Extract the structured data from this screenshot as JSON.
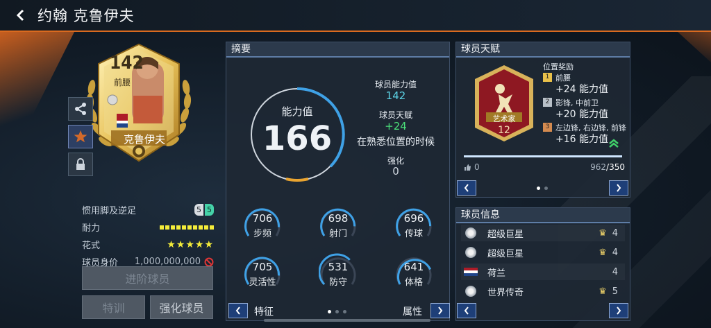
{
  "header": {
    "title": "约翰 克鲁伊夫"
  },
  "card": {
    "rating": "142",
    "position": "前腰",
    "name": "克鲁伊夫"
  },
  "left_stats": [
    {
      "label": "惯用脚及逆足",
      "value": "5 5"
    },
    {
      "label": "耐力",
      "value": ""
    },
    {
      "label": "花式",
      "value": "★★★★★"
    },
    {
      "label": "球员身价",
      "value": "1,000,000,000"
    }
  ],
  "stamina_level": 10,
  "buttons": {
    "advance": "进阶球员",
    "train": "特训",
    "strengthen": "强化球员"
  },
  "summary": {
    "title": "摘要",
    "ability_label": "能力值",
    "ability_value": "166",
    "player_ability_label": "球员能力值",
    "player_ability_value": "142",
    "talent_label": "球员天赋",
    "talent_value": "+24",
    "talent_desc": "在熟悉位置的时候",
    "strengthen_label": "强化",
    "strengthen_value": "0",
    "attrs": [
      {
        "value": "706",
        "label": "步频"
      },
      {
        "value": "698",
        "label": "射门"
      },
      {
        "value": "696",
        "label": "传球"
      },
      {
        "value": "705",
        "label": "灵活性"
      },
      {
        "value": "531",
        "label": "防守"
      },
      {
        "value": "641",
        "label": "体格"
      }
    ],
    "footer_left": "特征",
    "footer_right": "属性"
  },
  "talent": {
    "title": "球员天赋",
    "badge_name": "艺术家",
    "badge_level": "12",
    "bonus_title": "位置奖励",
    "bonuses": [
      {
        "rank": "1",
        "positions": "前腰",
        "bonus": "+24 能力值"
      },
      {
        "rank": "2",
        "positions": "影锋, 中前卫",
        "bonus": "+20 能力值"
      },
      {
        "rank": "3",
        "positions": "左边锋, 右边锋, 前锋",
        "bonus": "+16 能力值"
      }
    ],
    "likes": "0",
    "progress_current": "962",
    "progress_total": "/350"
  },
  "info": {
    "title": "球员信息",
    "rows": [
      {
        "label": "超级巨星",
        "value": "4"
      },
      {
        "label": "超级巨星",
        "value": "4"
      },
      {
        "label": "荷兰",
        "value": "4"
      },
      {
        "label": "世界传奇",
        "value": "5"
      }
    ]
  },
  "colors": {
    "accent_orange": "#d96a1f",
    "highlight_cyan": "#5cd3e6",
    "green": "#4be07a",
    "yellow": "#f4ec3a"
  }
}
